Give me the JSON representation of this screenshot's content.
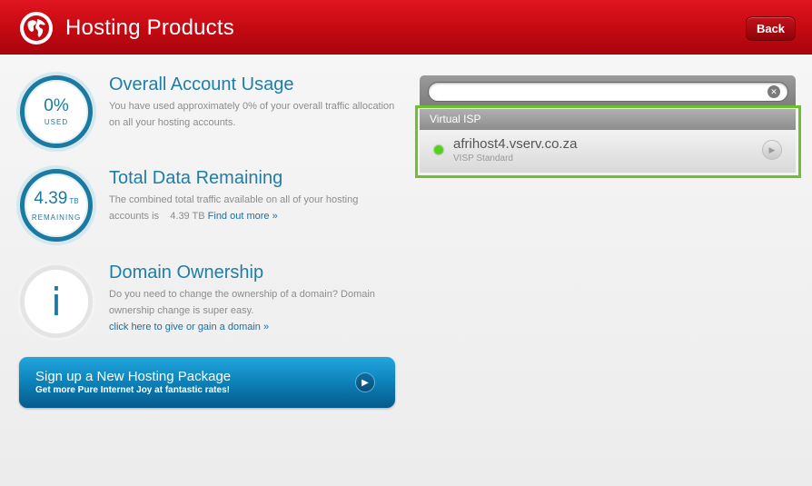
{
  "header": {
    "title": "Hosting Products",
    "back_label": "Back"
  },
  "stats": {
    "usage": {
      "value": "0%",
      "caption": "USED",
      "title": "Overall Account Usage",
      "text": "You have used approximately 0% of your overall traffic allocation on all your hosting accounts."
    },
    "remaining": {
      "value": "4.39",
      "unit": "TB",
      "caption": "REMAINING",
      "title": "Total Data Remaining",
      "text": "The combined total traffic available on all of your hosting accounts is",
      "amount": "4.39 TB",
      "link": "Find out more »"
    },
    "domain": {
      "icon_glyph": "i",
      "title": "Domain Ownership",
      "text": "Do you need to change the ownership of a domain? Domain ownership change is super easy.",
      "link": "click here to give or gain a domain »"
    }
  },
  "signup": {
    "title": "Sign up a New Hosting Package",
    "subtitle": "Get more Pure Internet Joy at fantastic rates!"
  },
  "panel": {
    "search": {
      "value": "",
      "placeholder": ""
    },
    "group_label": "Virtual ISP",
    "items": [
      {
        "name": "afrihost4.vserv.co.za",
        "type": "VISP Standard",
        "status_color": "#54d21e"
      }
    ]
  },
  "colors": {
    "brand_red": "#c40912",
    "accent_blue": "#1b7aa1",
    "highlight_green": "#6bc22a"
  }
}
